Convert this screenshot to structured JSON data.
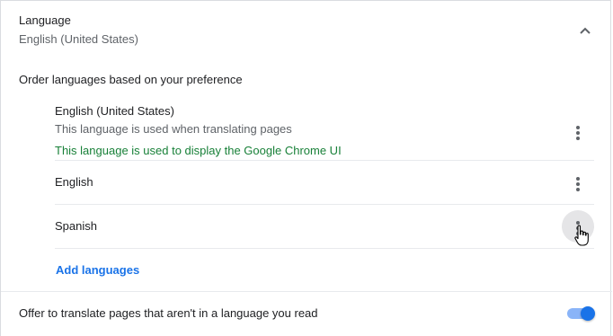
{
  "section": {
    "title": "Language",
    "subtitle": "English (United States)"
  },
  "order_label": "Order languages based on your preference",
  "languages": [
    {
      "name": "English (United States)",
      "note1": "This language is used when translating pages",
      "note2": "This language is used to display the Google Chrome UI"
    },
    {
      "name": "English"
    },
    {
      "name": "Spanish"
    }
  ],
  "add_languages_label": "Add languages",
  "offer_translate": {
    "label": "Offer to translate pages that aren't in a language you read",
    "enabled": true
  },
  "colors": {
    "accent": "#1a73e8",
    "green_text": "#188038",
    "secondary_text": "#5f6368"
  },
  "icons": {
    "collapse": "chevron-up-icon",
    "more": "more-vert-icon",
    "cursor": "hand-pointer-icon"
  }
}
